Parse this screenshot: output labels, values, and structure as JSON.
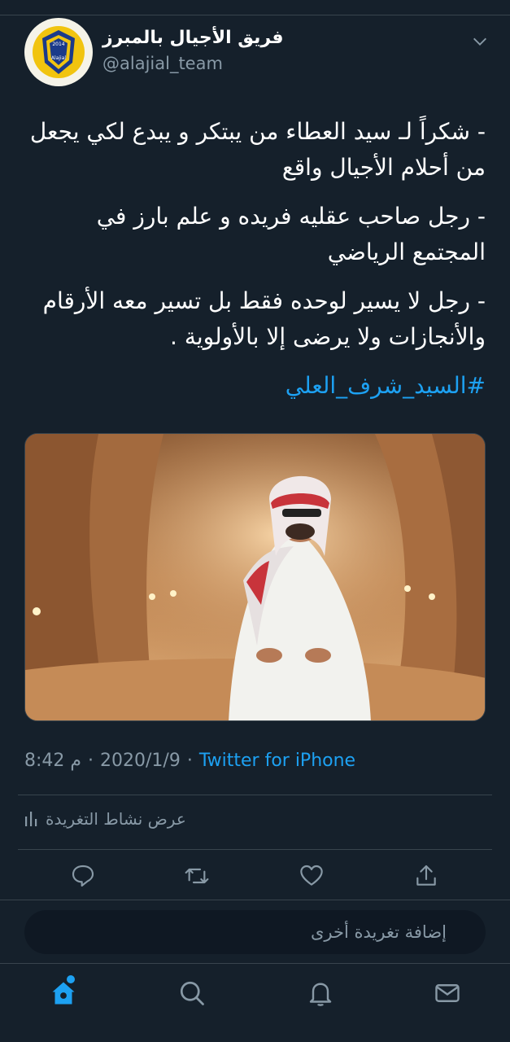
{
  "header": {
    "display_name": "فريق الأجيال بالمبرز",
    "handle": "@alajial_team",
    "avatar_badge_text": "Alajial"
  },
  "tweet": {
    "paragraphs": [
      "- شكراً لـ سيد العطاء من يبتكر و يبدع لكي يجعل من أحلام الأجيال واقع",
      "- رجل صاحب عقليه فريده و علم بارز في المجتمع الرياضي",
      "- رجل لا يسير لوحده فقط بل تسير معه الأرقام والأنجازات ولا يرضى إلا بالأولوية ."
    ],
    "hashtag": "#السيد_شرف_العلي",
    "time": "8:42 م",
    "date": "2020/1/9",
    "separator": "·",
    "source": "Twitter for iPhone"
  },
  "activity": {
    "label": "عرض نشاط التغريدة"
  },
  "composer": {
    "placeholder": "إضافة تغريدة أخرى"
  },
  "icons": {
    "chevron": "chevron-down-icon",
    "reply": "reply-icon",
    "retweet": "retweet-icon",
    "like": "heart-icon",
    "share": "share-icon",
    "home": "home-icon",
    "search": "search-icon",
    "notifications": "bell-icon",
    "messages": "mail-icon"
  },
  "colors": {
    "background": "#15202b",
    "accent": "#1da1f2",
    "secondary_text": "#8899a6",
    "divider": "#38444d"
  }
}
